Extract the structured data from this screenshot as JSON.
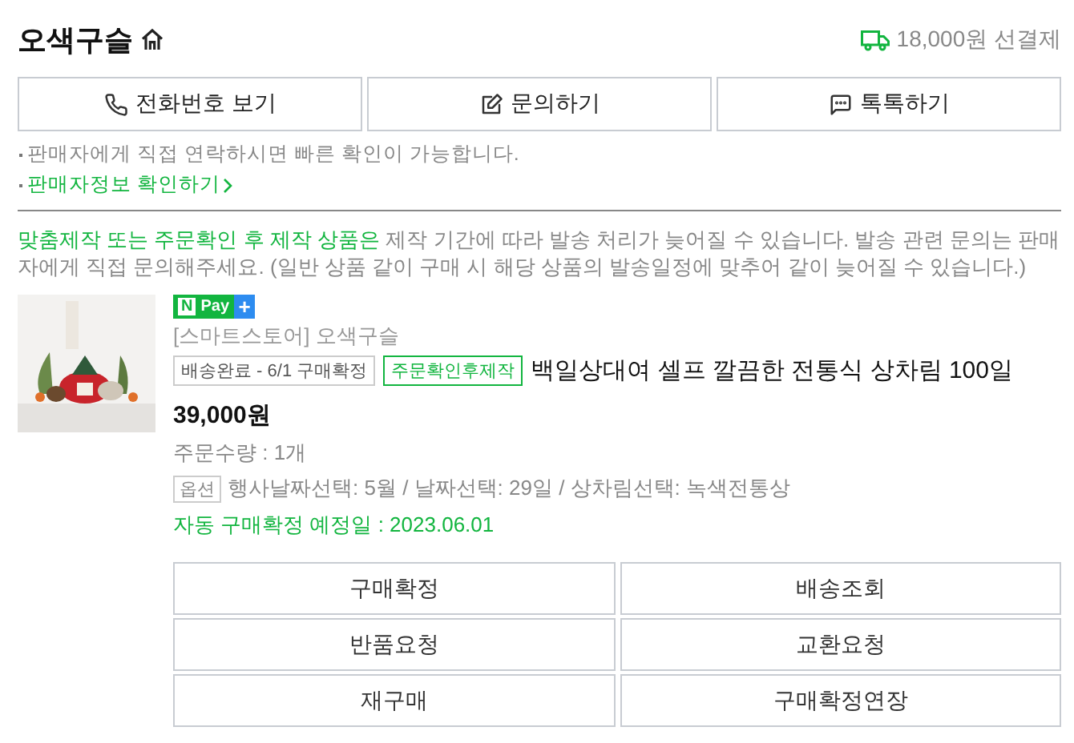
{
  "seller": {
    "name": "오색구슬",
    "shipping": "18,000원 선결제"
  },
  "contact_buttons": [
    {
      "kind": "phone",
      "label": "전화번호 보기"
    },
    {
      "kind": "inquiry",
      "label": "문의하기"
    },
    {
      "kind": "talk",
      "label": "톡톡하기"
    }
  ],
  "notes": [
    {
      "kind": "text",
      "text": "판매자에게 직접 연락하시면 빠른 확인이 가능합니다."
    },
    {
      "kind": "link",
      "text": "판매자정보 확인하기"
    }
  ],
  "notice": {
    "highlight": "맞춤제작 또는 주문확인 후 제작 상품은",
    "text": " 제작 기간에 따라 발송 처리가 늦어질 수 있습니다. 발송 관련 문의는 판매자에게 직접 문의해주세요. (일반 상품 같이 구매 시 해당 상품의 발송일정에 맞추어 같이 늦어질 수 있습니다.)"
  },
  "product": {
    "pay_badge": {
      "mark": "N",
      "label": "Pay",
      "plus": "+"
    },
    "store": "[스마트스토어] 오색구슬",
    "tags": [
      {
        "kind": "status",
        "text": "배송완료 - 6/1 구매확정"
      },
      {
        "kind": "made",
        "text": "주문확인후제작"
      }
    ],
    "title": "백일상대여 셀프 깔끔한 전통식 상차림 100일",
    "price": "39,000원",
    "quantity": "주문수량 : 1개",
    "option_label": "옵션",
    "option": "행사날짜선택: 5월 / 날짜선택: 29일 / 상차림선택: 녹색전통상",
    "auto_confirm": "자동 구매확정 예정일 : 2023.06.01"
  },
  "actions": [
    "구매확정",
    "배송조회",
    "반품요청",
    "교환요청",
    "재구매",
    "구매확정연장"
  ]
}
